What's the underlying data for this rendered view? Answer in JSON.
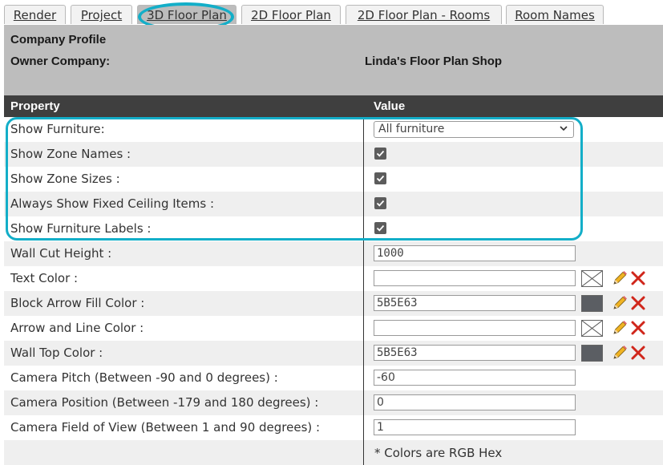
{
  "tabs": [
    {
      "label": "Render"
    },
    {
      "label": "Project"
    },
    {
      "label": "3D Floor Plan",
      "active": true
    },
    {
      "label": "2D Floor Plan"
    },
    {
      "label": "2D Floor Plan - Rooms"
    },
    {
      "label": "Room Names"
    }
  ],
  "header": {
    "company_profile": "Company Profile",
    "owner_label": "Owner Company:",
    "owner_value": "Linda's Floor Plan Shop"
  },
  "table": {
    "col_property": "Property",
    "col_value": "Value",
    "rows": [
      {
        "label": "Show Furniture:",
        "type": "select",
        "value": "All furniture"
      },
      {
        "label": "Show Zone Names :",
        "type": "checkbox",
        "checked": true
      },
      {
        "label": "Show Zone Sizes :",
        "type": "checkbox",
        "checked": true
      },
      {
        "label": "Always Show Fixed Ceiling Items :",
        "type": "checkbox",
        "checked": true
      },
      {
        "label": "Show Furniture Labels :",
        "type": "checkbox",
        "checked": true
      },
      {
        "label": "Wall Cut Height :",
        "type": "text",
        "value": "1000"
      },
      {
        "label": "Text Color :",
        "type": "color",
        "value": "",
        "swatch": null
      },
      {
        "label": "Block Arrow Fill Color :",
        "type": "color",
        "value": "5B5E63",
        "swatch": "#5B5E63"
      },
      {
        "label": "Arrow and Line Color :",
        "type": "color",
        "value": "",
        "swatch": null
      },
      {
        "label": "Wall Top Color :",
        "type": "color",
        "value": "5B5E63",
        "swatch": "#5B5E63"
      },
      {
        "label": "Camera Pitch (Between -90 and 0 degrees) :",
        "type": "text",
        "value": "-60"
      },
      {
        "label": "Camera Position (Between -179 and 180 degrees) :",
        "type": "text",
        "value": "0"
      },
      {
        "label": "Camera Field of View (Between 1 and 90 degrees) :",
        "type": "text",
        "value": "1"
      }
    ],
    "note": "* Colors are RGB Hex"
  },
  "colors": {
    "accent": "#13aec8",
    "header_bg": "#bdbdbd",
    "table_head_bg": "#3f3f3f"
  },
  "icons": {
    "edit": "pencil-icon",
    "delete": "red-x-icon",
    "no_color": "crossed-box-icon",
    "dropdown": "chevron-down-icon"
  }
}
